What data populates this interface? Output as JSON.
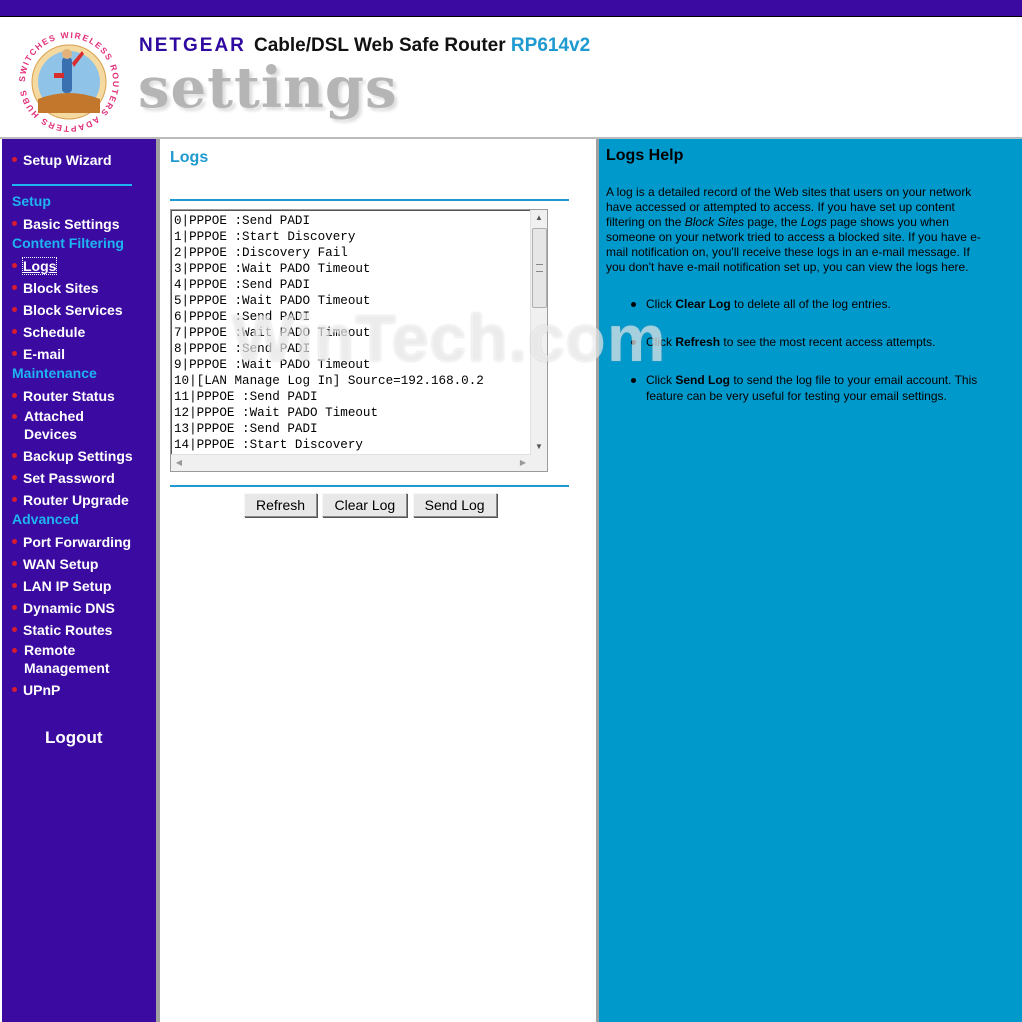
{
  "header": {
    "logo_seal_text": "SWITCHES WIRELESS ROUTERS ADAPTERS HUBS",
    "brand": "NETGEAR",
    "product": "Cable/DSL Web Safe Router",
    "model": "RP614v2",
    "section_word": "settings"
  },
  "colors": {
    "nav_background": "#3b0aa0",
    "accent": "#1eb4f0",
    "help_background": "#0099cc",
    "bullet": "#d81b2e"
  },
  "sidebar": {
    "setup_wizard": "Setup Wizard",
    "sections": {
      "setup": "Setup",
      "content_filtering": "Content Filtering",
      "maintenance": "Maintenance",
      "advanced": "Advanced"
    },
    "items": {
      "basic_settings": "Basic Settings",
      "logs": "Logs",
      "block_sites": "Block Sites",
      "block_services": "Block Services",
      "schedule": "Schedule",
      "email": "E-mail",
      "router_status": "Router Status",
      "attached_devices_1": "Attached",
      "attached_devices_2": "Devices",
      "backup_settings": "Backup Settings",
      "set_password": "Set Password",
      "router_upgrade": "Router Upgrade",
      "port_forwarding": "Port Forwarding",
      "wan_setup": "WAN Setup",
      "lan_ip_setup": "LAN IP Setup",
      "dynamic_dns": "Dynamic DNS",
      "static_routes": "Static Routes",
      "remote_management_1": "Remote",
      "remote_management_2": "Management",
      "upnp": "UPnP"
    },
    "logout": "Logout",
    "active_item": "Logs"
  },
  "main": {
    "title": "Logs",
    "log_lines": [
      "0|PPPOE :Send PADI",
      "1|PPPOE :Start Discovery",
      "2|PPPOE :Discovery Fail",
      "3|PPPOE :Wait PADO Timeout",
      "4|PPPOE :Send PADI",
      "5|PPPOE :Wait PADO Timeout",
      "6|PPPOE :Send PADI",
      "7|PPPOE :Wait PADO Timeout",
      "8|PPPOE :Send PADI",
      "9|PPPOE :Wait PADO Timeout",
      "10|[LAN Manage Log In] Source=192.168.0.2",
      "11|PPPOE :Send PADI",
      "12|PPPOE :Wait PADO Timeout",
      "13|PPPOE :Send PADI",
      "14|PPPOE :Start Discovery"
    ],
    "buttons": {
      "refresh": "Refresh",
      "clear_log": "Clear Log",
      "send_log": "Send Log"
    }
  },
  "help": {
    "title": "Logs Help",
    "para_1": "A log is a detailed record of the Web sites that users on your network have accessed or attempted to access. If you have set up content filtering on the ",
    "para_em_1": "Block Sites",
    "para_2": " page, the ",
    "para_em_2": "Logs",
    "para_3": " page shows you when someone on your network tried to access a blocked site. If you have e-mail notification on, you'll receive these logs in an e-mail message. If you don't have e-mail notification set up, you can view the logs here.",
    "bullets": [
      {
        "pre": "Click ",
        "strong": "Clear Log",
        "post": " to delete all of the log entries."
      },
      {
        "pre": "Click ",
        "strong": "Refresh",
        "post": " to see the most recent access attempts."
      },
      {
        "pre": "Click ",
        "strong": "Send Log",
        "post": " to send the log file to your email account. This feature can be very useful for testing your email settings."
      }
    ]
  },
  "watermark": "WinTech.com"
}
